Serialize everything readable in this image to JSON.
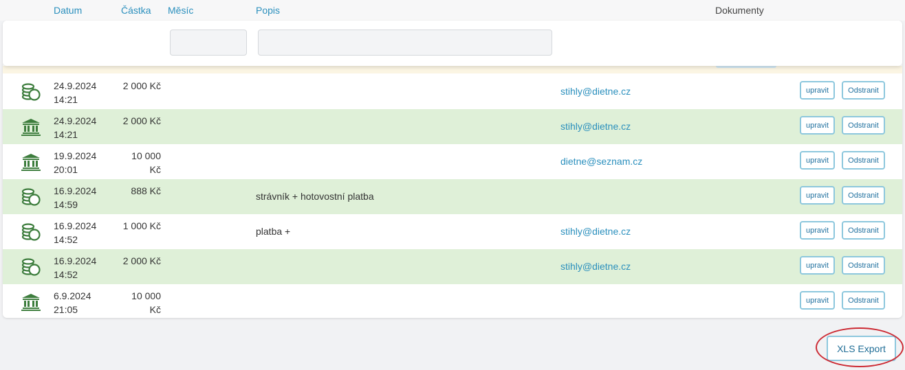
{
  "header": {
    "col_date": "Datum",
    "col_amount": "Částka",
    "col_month": "Měsíc",
    "col_description": "Popis",
    "col_documents": "Dokumenty"
  },
  "colors": {
    "row_highlight": "#dff0d8",
    "link": "#2a8fbd",
    "icon_green": "#3d7d3d",
    "button_border": "#8cc7dd",
    "annotation_red": "#cc2a33"
  },
  "rows": [
    {
      "icon": "coins-icon",
      "date": "24.9.2024",
      "time": "14:21",
      "amount_line1": "2 000 Kč",
      "amount_line2": "",
      "description": "",
      "email": "stihly@dietne.cz",
      "edit_label": "upravit",
      "delete_label": "Odstranit",
      "highlighted": false
    },
    {
      "icon": "bank-icon",
      "date": "24.9.2024",
      "time": "14:21",
      "amount_line1": "2 000 Kč",
      "amount_line2": "",
      "description": "",
      "email": "stihly@dietne.cz",
      "edit_label": "upravit",
      "delete_label": "Odstranit",
      "highlighted": true
    },
    {
      "icon": "bank-icon",
      "date": "19.9.2024",
      "time": "20:01",
      "amount_line1": "10 000",
      "amount_line2": "Kč",
      "description": "",
      "email": "dietne@seznam.cz",
      "edit_label": "upravit",
      "delete_label": "Odstranit",
      "highlighted": false
    },
    {
      "icon": "coins-icon",
      "date": "16.9.2024",
      "time": "14:59",
      "amount_line1": "888 Kč",
      "amount_line2": "",
      "description": "strávník + hotovostní platba",
      "email": "",
      "edit_label": "upravit",
      "delete_label": "Odstranit",
      "highlighted": true
    },
    {
      "icon": "coins-icon",
      "date": "16.9.2024",
      "time": "14:52",
      "amount_line1": "1 000 Kč",
      "amount_line2": "",
      "description": "platba +",
      "email": "stihly@dietne.cz",
      "edit_label": "upravit",
      "delete_label": "Odstranit",
      "highlighted": false
    },
    {
      "icon": "coins-icon",
      "date": "16.9.2024",
      "time": "14:52",
      "amount_line1": "2 000 Kč",
      "amount_line2": "",
      "description": "",
      "email": "stihly@dietne.cz",
      "edit_label": "upravit",
      "delete_label": "Odstranit",
      "highlighted": true
    },
    {
      "icon": "bank-icon",
      "date": "6.9.2024",
      "time": "21:05",
      "amount_line1": "10 000",
      "amount_line2": "Kč",
      "description": "",
      "email": "",
      "edit_label": "upravit",
      "delete_label": "Odstranit",
      "highlighted": false
    }
  ],
  "export": {
    "label": "XLS Export"
  }
}
